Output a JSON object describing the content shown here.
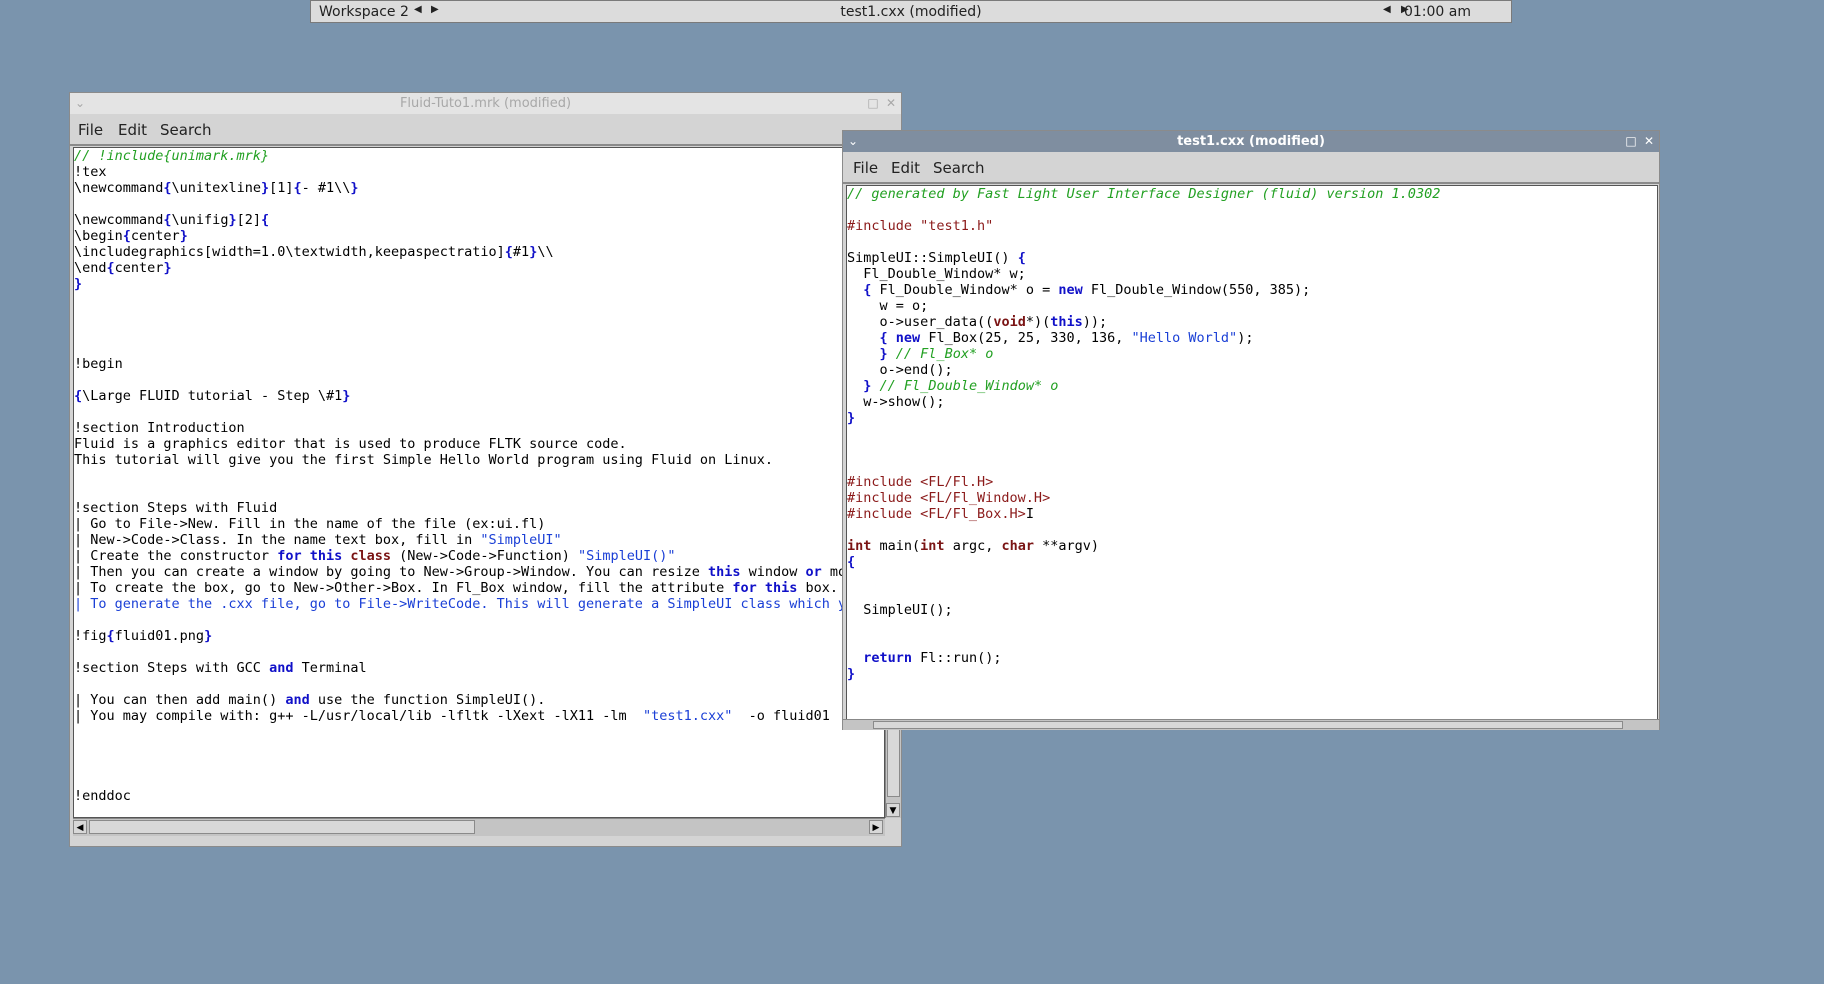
{
  "topbar": {
    "workspace": "Workspace 2",
    "title": "test1.cxx (modified)",
    "clock": "01:00 am"
  },
  "window1": {
    "title": "Fluid-Tuto1.mrk (modified)",
    "menu": [
      "File",
      "Edit",
      "Search"
    ],
    "lines": [
      [
        {
          "t": "// !include{unimark.mrk}",
          "c": "c"
        }
      ],
      [
        {
          "t": "!tex"
        }
      ],
      [
        {
          "t": "\\newcommand"
        },
        {
          "t": "{",
          "c": "b"
        },
        {
          "t": "\\unitexline"
        },
        {
          "t": "}",
          "c": "b"
        },
        {
          "t": "[1]"
        },
        {
          "t": "{",
          "c": "b"
        },
        {
          "t": "- #1\\\\"
        },
        {
          "t": "}",
          "c": "b"
        }
      ],
      [
        {
          "t": ""
        }
      ],
      [
        {
          "t": "\\newcommand"
        },
        {
          "t": "{",
          "c": "b"
        },
        {
          "t": "\\unifig"
        },
        {
          "t": "}",
          "c": "b"
        },
        {
          "t": "[2]"
        },
        {
          "t": "{",
          "c": "b"
        }
      ],
      [
        {
          "t": "\\begin"
        },
        {
          "t": "{",
          "c": "b"
        },
        {
          "t": "center"
        },
        {
          "t": "}",
          "c": "b"
        }
      ],
      [
        {
          "t": "\\includegraphics[width=1.0\\textwidth,keepaspectratio]"
        },
        {
          "t": "{",
          "c": "b"
        },
        {
          "t": "#1"
        },
        {
          "t": "}",
          "c": "b"
        },
        {
          "t": "\\\\"
        }
      ],
      [
        {
          "t": "\\end"
        },
        {
          "t": "{",
          "c": "b"
        },
        {
          "t": "center"
        },
        {
          "t": "}",
          "c": "b"
        }
      ],
      [
        {
          "t": "}",
          "c": "b"
        }
      ],
      [
        {
          "t": ""
        }
      ],
      [
        {
          "t": ""
        }
      ],
      [
        {
          "t": ""
        }
      ],
      [
        {
          "t": ""
        }
      ],
      [
        {
          "t": "!begin"
        }
      ],
      [
        {
          "t": ""
        }
      ],
      [
        {
          "t": "{",
          "c": "b"
        },
        {
          "t": "\\Large FLUID tutorial - Step \\#1"
        },
        {
          "t": "}",
          "c": "b"
        }
      ],
      [
        {
          "t": ""
        }
      ],
      [
        {
          "t": "!section Introduction"
        }
      ],
      [
        {
          "t": "Fluid is a graphics editor that is used to produce FLTK source code."
        }
      ],
      [
        {
          "t": "This tutorial will give you the first Simple Hello World program using Fluid on Linux."
        }
      ],
      [
        {
          "t": ""
        }
      ],
      [
        {
          "t": ""
        }
      ],
      [
        {
          "t": "!section Steps with Fluid"
        }
      ],
      [
        {
          "t": "| Go to File->New. Fill in the name of the file (ex:ui.fl)"
        }
      ],
      [
        {
          "t": "| New->Code->Class. In the name text box, fill in "
        },
        {
          "t": "\"SimpleUI\"",
          "c": "s"
        }
      ],
      [
        {
          "t": "| Create the constructor "
        },
        {
          "t": "for",
          "c": "k"
        },
        {
          "t": " "
        },
        {
          "t": "this",
          "c": "k"
        },
        {
          "t": " "
        },
        {
          "t": "class",
          "c": "t"
        },
        {
          "t": " (New->Code->Function) "
        },
        {
          "t": "\"SimpleUI()\"",
          "c": "s"
        }
      ],
      [
        {
          "t": "| Then you can create a window by going to New->Group->Window. You can resize "
        },
        {
          "t": "this",
          "c": "k"
        },
        {
          "t": " window "
        },
        {
          "t": "or",
          "c": "k"
        },
        {
          "t": " move it."
        }
      ],
      [
        {
          "t": "| To create the box, go to New->Other->Box. In Fl_Box window, fill the attribute "
        },
        {
          "t": "for",
          "c": "k"
        },
        {
          "t": " "
        },
        {
          "t": "this",
          "c": "k"
        },
        {
          "t": " box."
        }
      ],
      [
        {
          "t": "| To generate the .cxx file, go to File->WriteCode. This will generate a SimpleUI class which you can use.",
          "c": "bl"
        }
      ],
      [
        {
          "t": ""
        }
      ],
      [
        {
          "t": "!fig"
        },
        {
          "t": "{",
          "c": "b"
        },
        {
          "t": "fluid01.png"
        },
        {
          "t": "}",
          "c": "b"
        }
      ],
      [
        {
          "t": ""
        }
      ],
      [
        {
          "t": "!section Steps with GCC "
        },
        {
          "t": "and",
          "c": "k"
        },
        {
          "t": " Terminal"
        }
      ],
      [
        {
          "t": ""
        }
      ],
      [
        {
          "t": "| You can then add main() "
        },
        {
          "t": "and",
          "c": "k"
        },
        {
          "t": " use the function SimpleUI()."
        }
      ],
      [
        {
          "t": "| You may compile with: g++ -L/usr/local/lib -lfltk -lXext -lX11 -lm  "
        },
        {
          "t": "\"test1.cxx\"",
          "c": "s"
        },
        {
          "t": "  -o fluid01"
        }
      ],
      [
        {
          "t": ""
        }
      ],
      [
        {
          "t": ""
        }
      ],
      [
        {
          "t": ""
        }
      ],
      [
        {
          "t": ""
        }
      ],
      [
        {
          "t": "!enddoc"
        }
      ]
    ]
  },
  "window2": {
    "title": "test1.cxx (modified)",
    "menu": [
      "File",
      "Edit",
      "Search"
    ],
    "lines": [
      [
        {
          "t": "// generated by Fast Light User Interface Designer (fluid) version 1.0302",
          "c": "c"
        }
      ],
      [
        {
          "t": ""
        }
      ],
      [
        {
          "t": "#include \"test1.h\"",
          "c": "p"
        }
      ],
      [
        {
          "t": ""
        }
      ],
      [
        {
          "t": "SimpleUI::SimpleUI() "
        },
        {
          "t": "{",
          "c": "b"
        }
      ],
      [
        {
          "t": "  Fl_Double_Window* w;"
        }
      ],
      [
        {
          "t": "  "
        },
        {
          "t": "{",
          "c": "b"
        },
        {
          "t": " Fl_Double_Window* o = "
        },
        {
          "t": "new",
          "c": "k"
        },
        {
          "t": " Fl_Double_Window(550, 385);"
        }
      ],
      [
        {
          "t": "    w = o;"
        }
      ],
      [
        {
          "t": "    o->user_data(("
        },
        {
          "t": "void",
          "c": "t"
        },
        {
          "t": "*)("
        },
        {
          "t": "this",
          "c": "k"
        },
        {
          "t": "));"
        }
      ],
      [
        {
          "t": "    "
        },
        {
          "t": "{",
          "c": "b"
        },
        {
          "t": " "
        },
        {
          "t": "new",
          "c": "k"
        },
        {
          "t": " Fl_Box(25, 25, 330, 136, "
        },
        {
          "t": "\"Hello World\"",
          "c": "s"
        },
        {
          "t": ");"
        }
      ],
      [
        {
          "t": "    "
        },
        {
          "t": "}",
          "c": "b"
        },
        {
          "t": " "
        },
        {
          "t": "// Fl_Box* o",
          "c": "c"
        }
      ],
      [
        {
          "t": "    o->end();"
        }
      ],
      [
        {
          "t": "  "
        },
        {
          "t": "}",
          "c": "b"
        },
        {
          "t": " "
        },
        {
          "t": "// Fl_Double_Window* o",
          "c": "c"
        }
      ],
      [
        {
          "t": "  w->show();"
        }
      ],
      [
        {
          "t": "}",
          "c": "b"
        }
      ],
      [
        {
          "t": ""
        }
      ],
      [
        {
          "t": ""
        }
      ],
      [
        {
          "t": ""
        }
      ],
      [
        {
          "t": "#include <FL/Fl.H>",
          "c": "p"
        }
      ],
      [
        {
          "t": "#include <FL/Fl_Window.H>",
          "c": "p"
        }
      ],
      [
        {
          "t": "#include <FL/Fl_Box.H>",
          "c": "p"
        },
        {
          "t": "I",
          "c": "cursor"
        }
      ],
      [
        {
          "t": ""
        }
      ],
      [
        {
          "t": "int",
          "c": "t"
        },
        {
          "t": " main("
        },
        {
          "t": "int",
          "c": "t"
        },
        {
          "t": " argc, "
        },
        {
          "t": "char",
          "c": "t"
        },
        {
          "t": " **argv)"
        }
      ],
      [
        {
          "t": "{",
          "c": "b"
        }
      ],
      [
        {
          "t": ""
        }
      ],
      [
        {
          "t": ""
        }
      ],
      [
        {
          "t": "  SimpleUI();"
        }
      ],
      [
        {
          "t": ""
        }
      ],
      [
        {
          "t": ""
        }
      ],
      [
        {
          "t": "  "
        },
        {
          "t": "return",
          "c": "k"
        },
        {
          "t": " Fl::run();"
        }
      ],
      [
        {
          "t": "}",
          "c": "b"
        }
      ]
    ]
  }
}
